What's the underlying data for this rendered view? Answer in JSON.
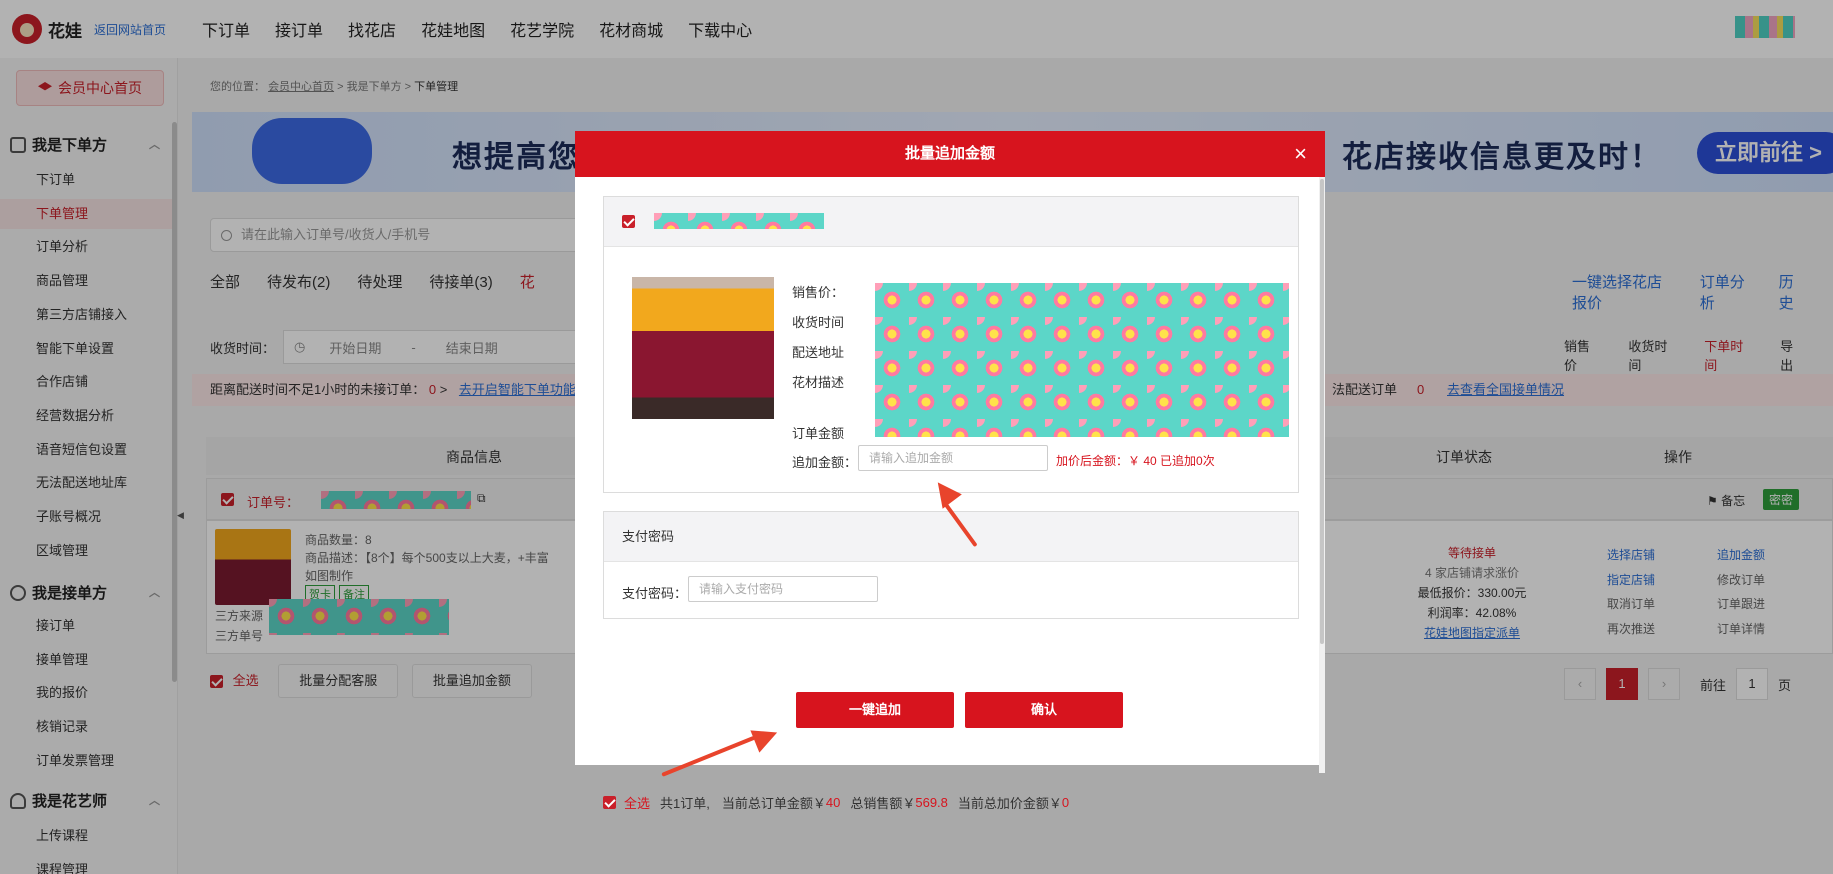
{
  "brand": {
    "name": "花娃",
    "back_link": "返回网站首页"
  },
  "topnav": [
    "下订单",
    "接订单",
    "找花店",
    "花娃地图",
    "花艺学院",
    "花材商城",
    "下载中心"
  ],
  "sidebar": {
    "member_home": "会员中心首页",
    "sections": [
      {
        "title": "我是下单方",
        "items": [
          "下订单",
          "下单管理",
          "订单分析",
          "商品管理",
          "第三方店铺接入",
          "智能下单设置",
          "合作店铺",
          "经营数据分析",
          "语音短信包设置",
          "无法配送地址库",
          "子账号概况",
          "区域管理"
        ]
      },
      {
        "title": "我是接单方",
        "items": [
          "接订单",
          "接单管理",
          "我的报价",
          "核销记录",
          "订单发票管理"
        ]
      },
      {
        "title": "我是花艺师",
        "items": [
          "上传课程",
          "课程管理"
        ]
      }
    ],
    "active_item": "下单管理"
  },
  "breadcrumb": {
    "prefix": "您的位置：",
    "home": "会员中心首页",
    "level2": "我是下单方",
    "current": "下单管理"
  },
  "banner": {
    "text_left": "想提高您的",
    "text_right": "花店接收信息更及时！",
    "cta": "立即前往 >"
  },
  "search": {
    "placeholder": "请在此输入订单号/收货人/手机号"
  },
  "tabs": [
    "全部",
    "待发布(2)",
    "待处理",
    "待接单(3)",
    "花"
  ],
  "right_links": [
    "一键选择花店报价",
    "订单分析",
    "历史"
  ],
  "filter": {
    "label": "收货时间：",
    "start": "开始日期",
    "sep": "-",
    "end": "结束日期"
  },
  "sort": [
    "销售价",
    "收货时间",
    "下单时间",
    "导出"
  ],
  "alert": {
    "text": "距离配送时间不足1小时的未接订单：",
    "count": "0",
    "link": "去开启智能下单功能",
    "right_text": "法配送订单",
    "right_count": "0",
    "right_link": "去查看全国接单情况"
  },
  "table_head": {
    "col1": "商品信息",
    "col2": "订单状态",
    "col3": "操作"
  },
  "order": {
    "no_label": "订单号：",
    "note_btn": "备忘",
    "secret_btn": "密密",
    "qty": "商品数量：8",
    "desc": "商品描述：【8个】每个500支以上大麦，+丰富",
    "desc2": "如图制作",
    "tags": [
      "贺卡",
      "备注"
    ],
    "source_label": "三方来源",
    "source_no_label": "三方单号",
    "status": "等待接单",
    "shops": "4 家店铺请求涨价",
    "low_price": "最低报价：330.00元",
    "profit": "利润率：42.08%",
    "map_link": "花娃地图指定派单",
    "ops": [
      "选择店铺",
      "追加金额",
      "指定店铺",
      "修改订单",
      "取消订单",
      "订单跟进",
      "再次推送",
      "订单详情"
    ]
  },
  "bottom": {
    "select_all": "全选",
    "btn1": "批量分配客服",
    "btn2": "批量追加金额"
  },
  "pager": {
    "current": "1",
    "goto": "前往",
    "page_input": "1",
    "page_unit": "页"
  },
  "modal": {
    "title": "批量追加金额",
    "close": "×",
    "fields": {
      "price": "销售价：",
      "recv_time": "收货时间",
      "address": "配送地址",
      "material": "花材描述",
      "order_amount": "订单金额",
      "add_amount": "追加金额："
    },
    "add_placeholder": "请输入追加金额",
    "after_price": "加价后金额：￥ 40  已追加0次",
    "pay_section": "支付密码",
    "pay_label": "支付密码：",
    "pay_placeholder": "请输入支付密码",
    "summary": {
      "select_all": "全选",
      "count": "共1订单,",
      "order_total_label": "当前总订单金额￥",
      "order_total": "40",
      "sale_total_label": "总销售额￥",
      "sale_total": "569.8",
      "add_total_label": "当前总加价金额￥",
      "add_total": "0"
    },
    "btn_add": "一键追加",
    "btn_confirm": "确认"
  }
}
